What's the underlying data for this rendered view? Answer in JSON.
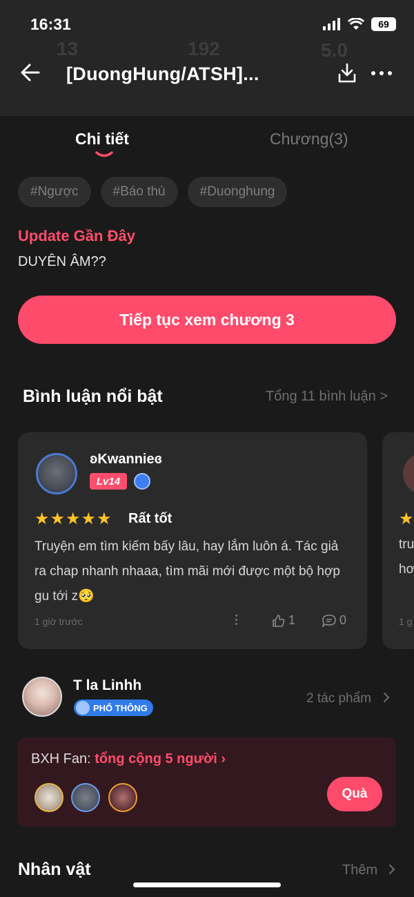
{
  "status_bar": {
    "time": "16:31",
    "battery": "69"
  },
  "header": {
    "title": "[DuongHung/ATSH]...",
    "background_stats": [
      "13",
      "192",
      "5.0"
    ]
  },
  "tabs": [
    {
      "label": "Chi tiết",
      "active": true
    },
    {
      "label": "Chương(3)",
      "active": false
    }
  ],
  "tags": [
    "#Ngược",
    "#Báo thù",
    "#Duonghung"
  ],
  "update": {
    "label": "Update Gần Đây",
    "text": "DUYÊN ÂM??"
  },
  "continue_button": "Tiếp tục xem chương 3",
  "comments_section": {
    "title": "Bình luận nổi bật",
    "total_link": "Tổng 11 bình luận >",
    "comments": [
      {
        "username": "ʚKwannieɞ",
        "level": "Lv14",
        "rating": 5,
        "rating_label": "Rất tốt",
        "text": "Truyện em tìm kiếm bấy lâu, hay lắm luôn á. Tác giả ra chap nhanh nhaaa, tìm mãi mới được một bộ hợp gu tới z🥺",
        "time": "1 giờ trước",
        "likes": "1",
        "replies": "0"
      }
    ],
    "peek_text": [
      "tru",
      "hơ",
      "1 g"
    ]
  },
  "author": {
    "name": "T la Linhh",
    "badge": "PHỔ THÔNG",
    "works": "2 tác phẩm"
  },
  "fan_ranking": {
    "label": "BXH Fan:",
    "count": "tổng cộng 5 người",
    "gift_button": "Quà"
  },
  "characters_section": {
    "title": "Nhân vật",
    "more": "Thêm"
  },
  "colors": {
    "accent": "#ff4b6b",
    "background": "#1a1a1a",
    "card": "#2a2a2a",
    "star": "#ffc12b"
  }
}
